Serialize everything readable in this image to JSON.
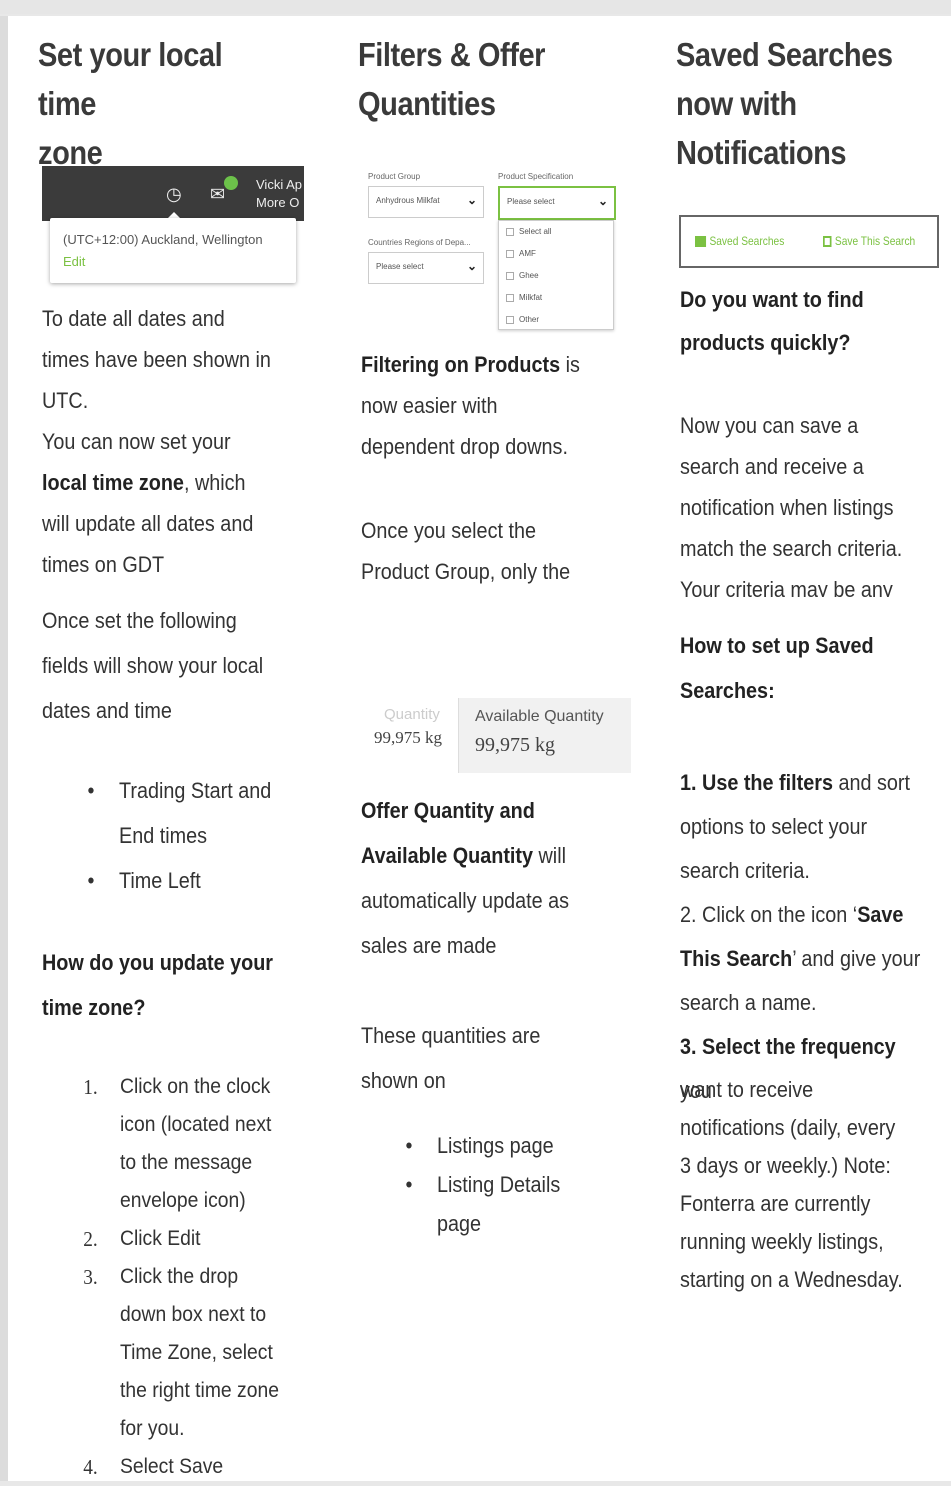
{
  "col1": {
    "title_line1": "Set your local time",
    "title_line2": "zone",
    "screenshot": {
      "user_name_line1": "Vicki Ap",
      "user_name_line2": "More O",
      "timezone": "(UTC+12:00) Auckland, Wellington",
      "edit_link": "Edit"
    },
    "para1": [
      "To date all dates and",
      "times have been shown in",
      "UTC."
    ],
    "para2_line1": "You can now set your",
    "para2_bold": "local time zone",
    "para2_rest": ", which",
    "para2_more": [
      "will update all dates and",
      "times on GDT"
    ],
    "para3": [
      "Once set the following",
      "fields will show your local",
      "dates and time"
    ],
    "bullets": [
      {
        "lines": [
          "Trading Start and",
          "End times"
        ]
      },
      {
        "lines": [
          "Time Left"
        ]
      }
    ],
    "heading": [
      "How do you update your",
      "time zone?"
    ],
    "steps": [
      {
        "n": "1.",
        "lines": [
          "Click on the clock",
          "icon (located next",
          "to the message",
          "envelope icon)"
        ]
      },
      {
        "n": "2.",
        "lines": [
          "Click Edit"
        ]
      },
      {
        "n": "3.",
        "lines": [
          "Click the drop",
          "down box next to",
          "Time Zone, select",
          "the right time zone",
          "for you."
        ]
      },
      {
        "n": "4.",
        "lines": [
          "Select Save"
        ]
      }
    ]
  },
  "col2": {
    "title_line1": "Filters & Offer",
    "title_line2": "Quantities",
    "filter_shot": {
      "product_group_label": "Product Group",
      "product_group_value": "Anhydrous Milkfat",
      "product_spec_label": "Product Specification",
      "product_spec_value": "Please select",
      "countries_label": "Countries Regions of Depa...",
      "countries_value": "Please select",
      "options": [
        "Select all",
        "AMF",
        "Ghee",
        "Milkfat",
        "Other"
      ]
    },
    "para1_bold": "Filtering on Products",
    "para1_rest": " is",
    "para1_more": [
      "now easier with",
      "dependent drop downs."
    ],
    "para2": [
      "Once you select the",
      "Product Group, only the"
    ],
    "qty_shot": {
      "quantity_label": "Quantity",
      "quantity_value": "99,975 kg",
      "available_label": "Available Quantity",
      "available_value": "99,975 kg"
    },
    "para3_bold1": "Offer Quantity and",
    "para3_bold2": "Available Quantity",
    "para3_rest": " will",
    "para3_more": [
      "automatically update as",
      "sales are made"
    ],
    "para4": [
      "These quantities are",
      "shown on"
    ],
    "bullets": [
      {
        "lines": [
          "Listings page"
        ]
      },
      {
        "lines": [
          "Listing Details",
          "page"
        ]
      }
    ]
  },
  "col3": {
    "title_line1": "Saved Searches",
    "title_line2": "now with",
    "title_line3": "Notifications",
    "bar": {
      "saved_searches": "Saved Searches",
      "save_this_search": "Save This Search"
    },
    "question": [
      "Do you want to find",
      "products quickly?"
    ],
    "para1": [
      "Now you can save a",
      "search and receive a",
      "notification when listings",
      "match the search criteria.",
      "Your criteria may be any"
    ],
    "heading": [
      "How to set up Saved",
      "Searches:"
    ],
    "step1_bold": "1. Use the filters",
    "step1_rest": " and sort",
    "step1_more": [
      "options to select your",
      "search criteria."
    ],
    "step2_a": "2. Click on the icon ‘",
    "step2_bold": "Save",
    "step2_bold2": "This Search",
    "step2_b": "’ and give your",
    "step2_more": "search a name.",
    "step3_bold": "3. Select the frequency",
    "step3_rest": " you",
    "step3_more": [
      "want to receive",
      "notifications (daily, every",
      "3 days or weekly.) Note:",
      "Fonterra are currently",
      "running weekly listings,",
      "starting on a Wednesday."
    ]
  }
}
